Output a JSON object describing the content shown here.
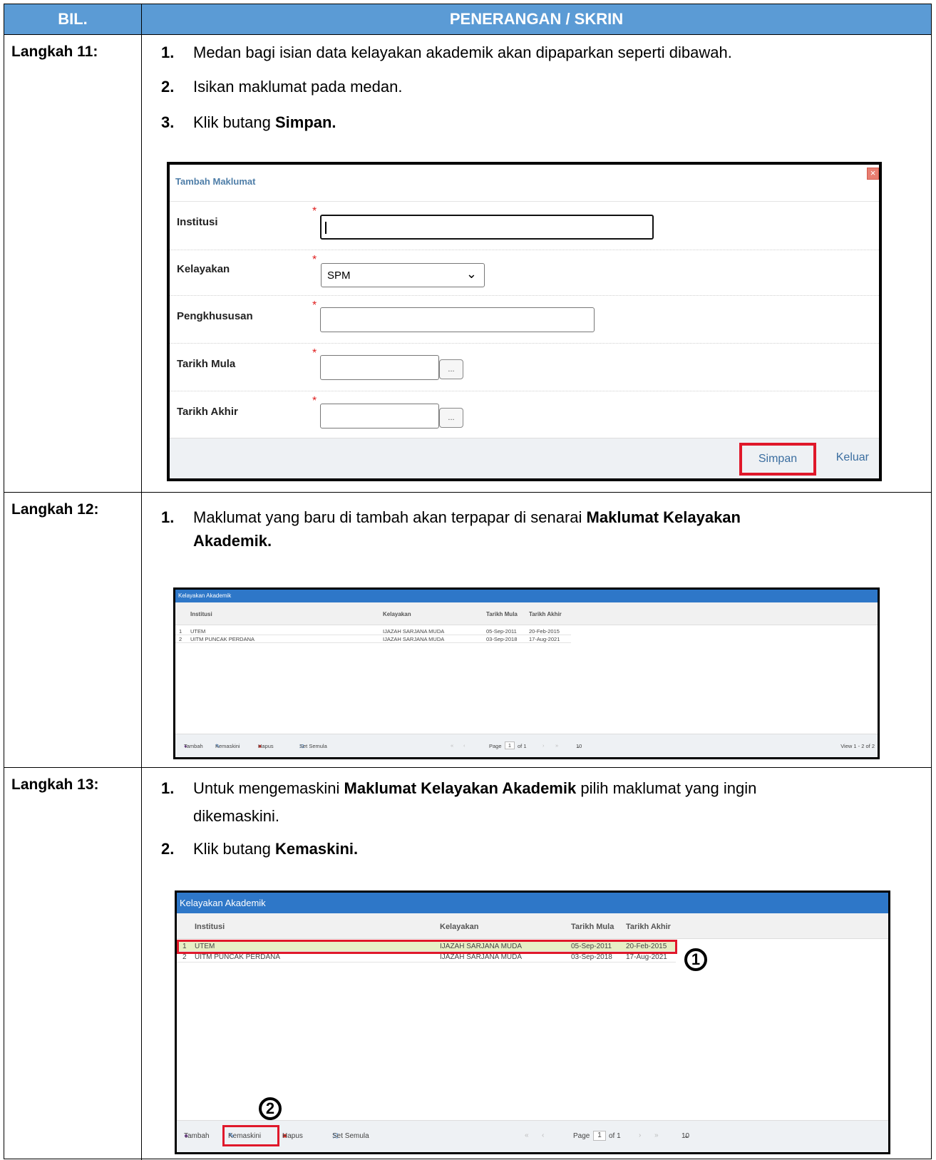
{
  "header": {
    "bil": "BIL.",
    "penerangan": "PENERANGAN / SKRIN"
  },
  "step11": {
    "label": "Langkah 11:",
    "items": [
      {
        "num": "1.",
        "text": "Medan bagi isian data kelayakan akademik akan dipaparkan seperti dibawah."
      },
      {
        "num": "2.",
        "text": "Isikan maklumat pada medan."
      },
      {
        "num": "3.",
        "text_pre": "Klik butang ",
        "text_bold": "Simpan."
      }
    ],
    "dialog": {
      "title": "Tambah Maklumat",
      "close_glyph": "×",
      "fields": [
        {
          "label": "Institusi",
          "required": "*",
          "value": ""
        },
        {
          "label": "Kelayakan",
          "required": "*",
          "value": "SPM"
        },
        {
          "label": "Pengkhususan",
          "required": "*",
          "value": ""
        },
        {
          "label": "Tarikh Mula",
          "required": "*",
          "value": "",
          "picker": "..."
        },
        {
          "label": "Tarikh Akhir",
          "required": "*",
          "value": "",
          "picker": "..."
        }
      ],
      "buttons": {
        "save": "Simpan",
        "exit": "Keluar"
      }
    }
  },
  "step12": {
    "label": "Langkah 12:",
    "items": [
      {
        "num": "1.",
        "text_pre": "Maklumat yang baru di tambah akan terpapar di senarai ",
        "text_bold": "Maklumat Kelayakan",
        "text_bold2": "Akademik."
      }
    ]
  },
  "step13": {
    "label": "Langkah 13:",
    "items": [
      {
        "num": "1.",
        "text_pre": "Untuk mengemaskini ",
        "text_bold": "Maklumat Kelayakan Akademik",
        "text_post": " pilih maklumat yang ingin",
        "text_line2": "dikemaskini."
      },
      {
        "num": "2.",
        "text_pre": "Klik butang ",
        "text_bold": "Kemaskini."
      }
    ],
    "callouts": [
      "1",
      "2"
    ]
  },
  "grid": {
    "title": "Kelayakan Akademik",
    "columns": [
      "Institusi",
      "Kelayakan",
      "Tarikh Mula",
      "Tarikh Akhir"
    ],
    "rows": [
      {
        "no": "1",
        "institusi": "UTEM",
        "kelayakan": "IJAZAH SARJANA MUDA",
        "mula": "05-Sep-2011",
        "akhir": "20-Feb-2015"
      },
      {
        "no": "2",
        "institusi": "UITM PUNCAK PERDANA",
        "kelayakan": "IJAZAH SARJANA MUDA",
        "mula": "03-Sep-2018",
        "akhir": "17-Aug-2021"
      }
    ],
    "toolbar": {
      "add": "Tambah",
      "edit": "Kemaskini",
      "delete": "Hapus",
      "reset": "Set Semula"
    },
    "pager": {
      "page_label": "Page",
      "page": "1",
      "of": "of 1",
      "size": "10",
      "view": "View 1 - 2 of 2"
    }
  },
  "colors": {
    "header_bg": "#5b9bd5",
    "grid_title_bg": "#2e77c8",
    "highlight": "#e0182a",
    "selected_row": "#e7efc5"
  }
}
